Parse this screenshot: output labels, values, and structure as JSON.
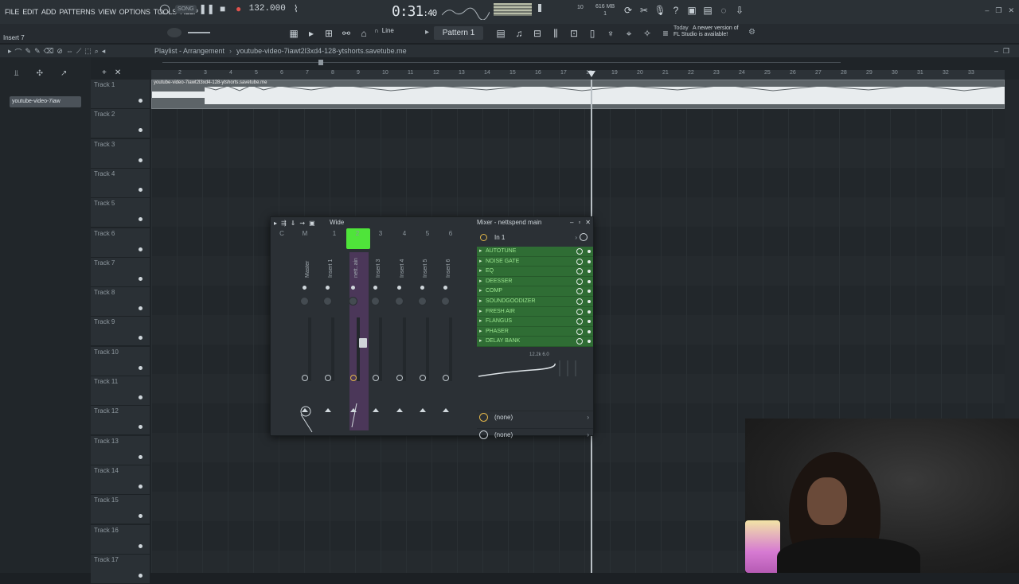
{
  "menu": [
    "FILE",
    "EDIT",
    "ADD",
    "PATTERNS",
    "VIEW",
    "OPTIONS",
    "TOOLS",
    "HELP"
  ],
  "transport": {
    "song_label": "SONG",
    "tempo": "132.000",
    "time_main": "0:31",
    "time_sub": ":40",
    "time_unit": "MSCS"
  },
  "cpu": {
    "memory": "616 MB",
    "voices": "10",
    "cores": "1"
  },
  "hint_text": "Insert 7",
  "snap_label": "Line",
  "pattern_label": "Pattern 1",
  "news": {
    "day": "Today",
    "message_line1": "A newer version of",
    "message_line2": "FL Studio is available!"
  },
  "playlist": {
    "title": "Playlist - Arrangement",
    "breadcrumb": "youtube-video-7iawt2l3xd4-128-ytshorts.savetube.me",
    "clip_tab": "youtube-video-7iaw",
    "clip_name": "youtube-video-7iawt2l3xd4-128-ytshorts.savetube.me",
    "ruler": [
      "2",
      "3",
      "4",
      "5",
      "6",
      "7",
      "8",
      "9",
      "10",
      "11",
      "12",
      "13",
      "14",
      "15",
      "16",
      "17",
      "18",
      "19",
      "20",
      "21",
      "22",
      "23",
      "24",
      "25",
      "26",
      "27",
      "28",
      "29",
      "30",
      "31",
      "32",
      "33"
    ],
    "tracks": [
      "Track 1",
      "Track 2",
      "Track 3",
      "Track 4",
      "Track 5",
      "Track 6",
      "Track 7",
      "Track 8",
      "Track 9",
      "Track 10",
      "Track 11",
      "Track 12",
      "Track 13",
      "Track 14",
      "Track 15",
      "Track 16",
      "Track 17"
    ]
  },
  "mixer": {
    "view_label": "Wide",
    "title": "Mixer - nettspend main",
    "input": "In 1",
    "channel_numbers": [
      "C",
      "M",
      "1",
      "2",
      "3",
      "4",
      "5",
      "6"
    ],
    "channel_names": [
      "Master",
      "Insert 1",
      "nett..ain",
      "Insert 3",
      "Insert 4",
      "Insert 5",
      "Insert 6"
    ],
    "fx_slots": [
      "AUTOTUNE",
      "NOISE GATE",
      "EQ",
      "DEESSER",
      "COMP",
      "SOUNDGOODIZER",
      "FRESH AIR",
      "FLANGUS",
      "PHASER",
      "DELAY BANK"
    ],
    "eq_label": "12.2k 6.0",
    "send1": "(none)",
    "send2": "(none)"
  },
  "colors": {
    "accent_green": "#4fe43a",
    "fx_slot": "#2f6d34",
    "selected_strip": "#5a3b6a"
  }
}
